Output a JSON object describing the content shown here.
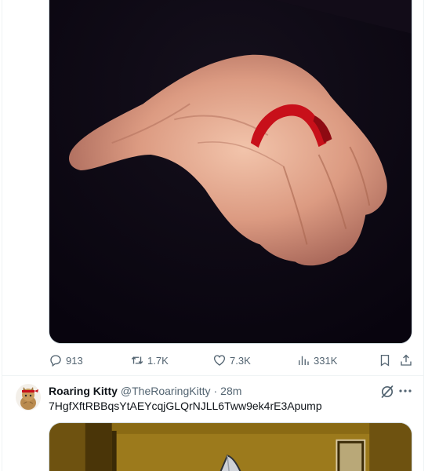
{
  "first_tweet": {
    "media": {
      "alt": "",
      "icon": "hand-with-red-ribbon-image"
    },
    "actions": {
      "replies": "913",
      "reposts": "1.7K",
      "likes": "7.3K",
      "views": "331K"
    }
  },
  "second_tweet": {
    "display_name": "Roaring Kitty",
    "handle": "@TheRoaringKitty",
    "separator": "·",
    "time": "28m",
    "text": "7HgfXftRBBqsYtAEYcqjGLQrNJLL6Tww9ek4rE3Apump",
    "avatar_icon": "cat-avatar-icon",
    "media_icon": "gold-room-image"
  },
  "colors": {
    "text_primary": "#0f1419",
    "text_secondary": "#536471",
    "border": "#eff3f4",
    "media_border": "#cfd9de",
    "ribbon_red": "#c8101a",
    "media_bg_dark": "#0d0614",
    "media_bg_gold": "#9c7a1c"
  }
}
